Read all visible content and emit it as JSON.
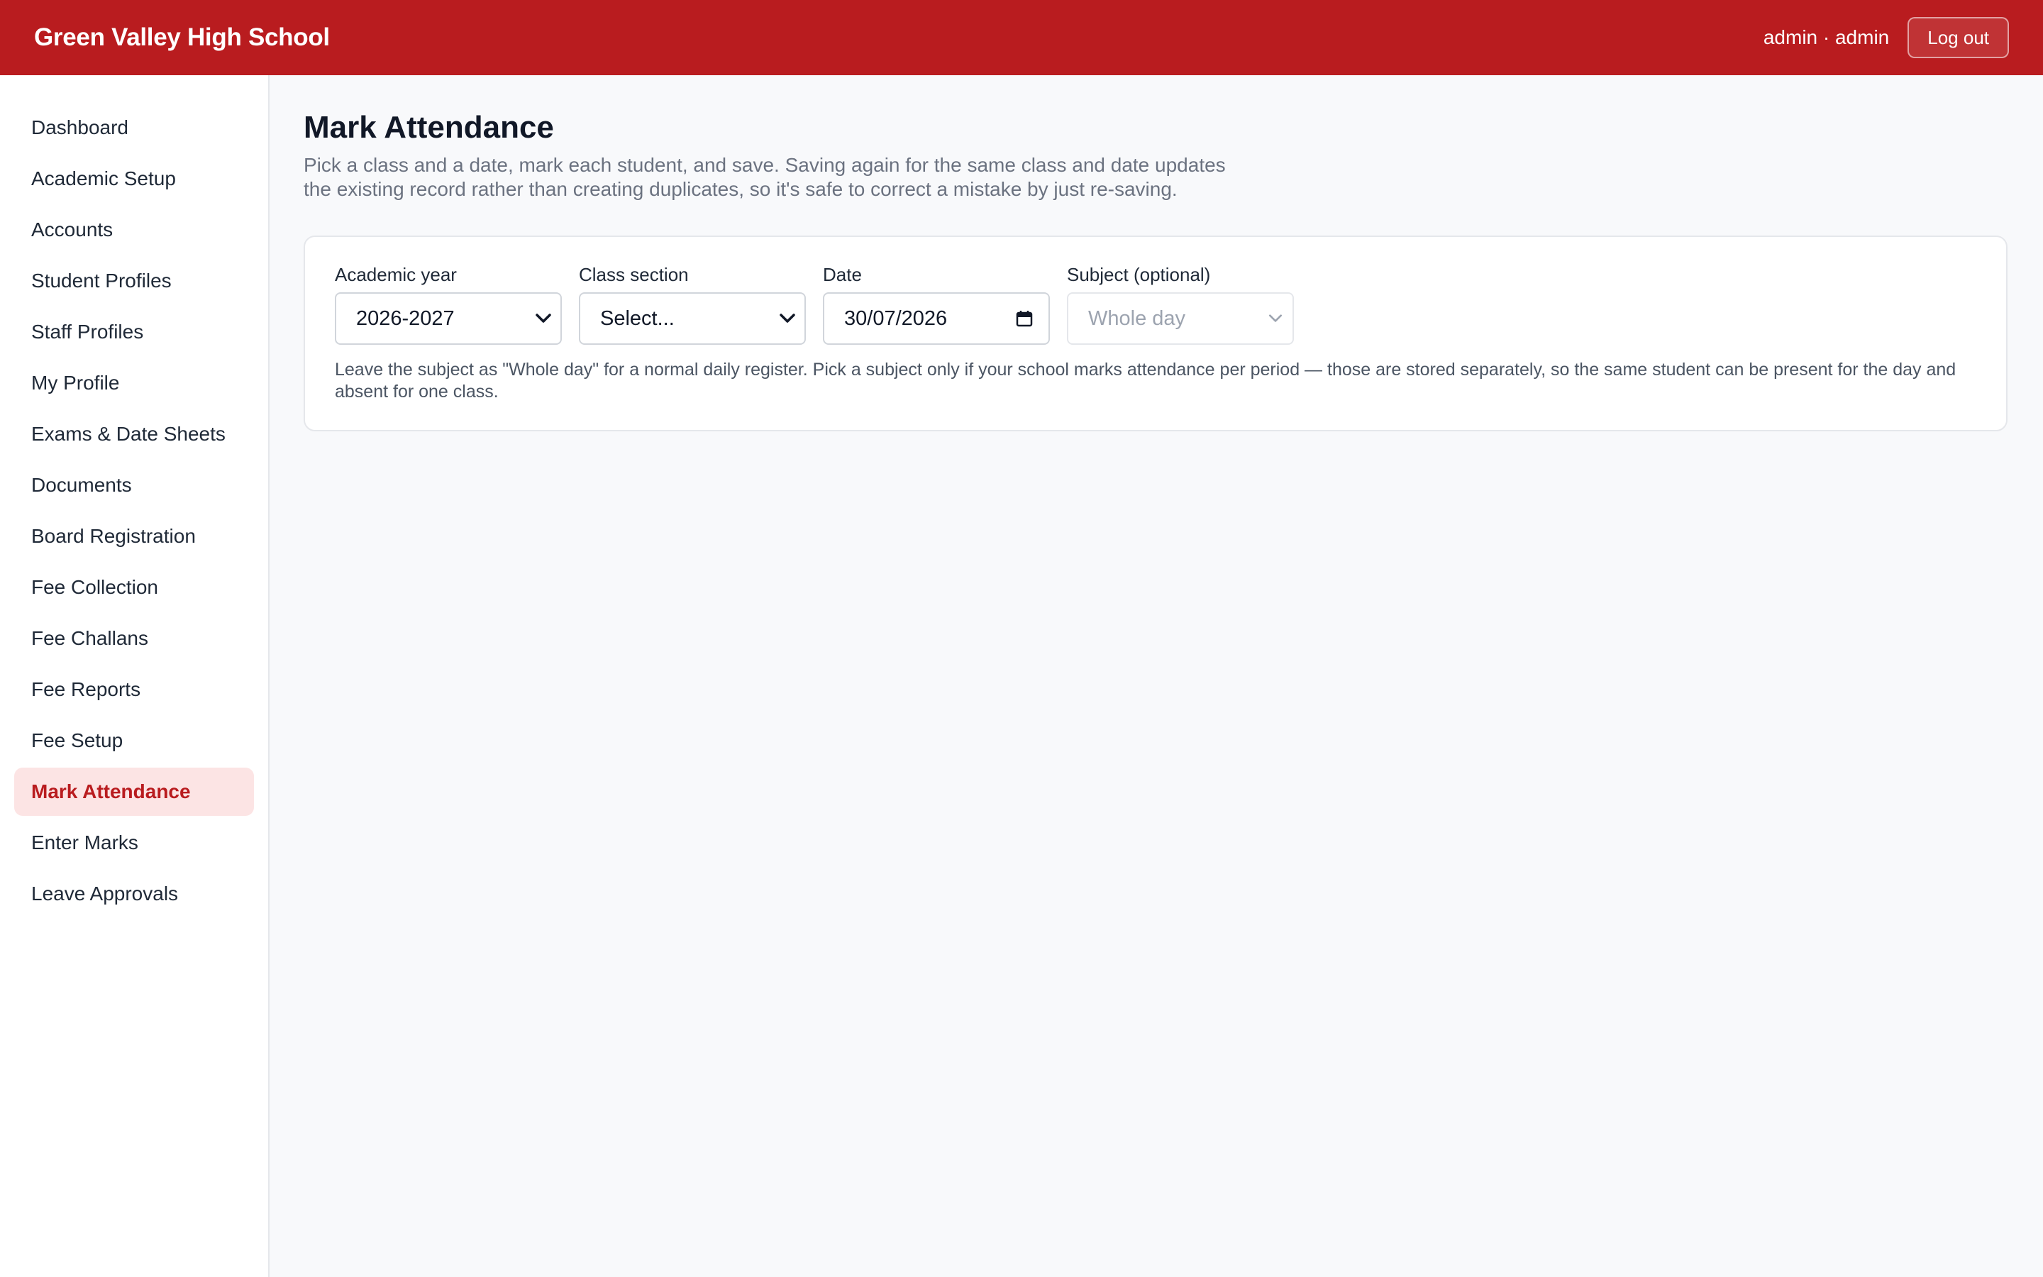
{
  "header": {
    "school_name": "Green Valley High School",
    "user_label": "admin · admin",
    "logout_label": "Log out"
  },
  "sidebar": {
    "items": [
      {
        "label": "Dashboard"
      },
      {
        "label": "Academic Setup"
      },
      {
        "label": "Accounts"
      },
      {
        "label": "Student Profiles"
      },
      {
        "label": "Staff Profiles"
      },
      {
        "label": "My Profile"
      },
      {
        "label": "Exams & Date Sheets"
      },
      {
        "label": "Documents"
      },
      {
        "label": "Board Registration"
      },
      {
        "label": "Fee Collection"
      },
      {
        "label": "Fee Challans"
      },
      {
        "label": "Fee Reports"
      },
      {
        "label": "Fee Setup"
      },
      {
        "label": "Mark Attendance",
        "active": true
      },
      {
        "label": "Enter Marks"
      },
      {
        "label": "Leave Approvals"
      }
    ]
  },
  "page": {
    "title": "Mark Attendance",
    "description": "Pick a class and a date, mark each student, and save. Saving again for the same class and date updates the existing record rather than creating duplicates, so it's safe to correct a mistake by just re-saving."
  },
  "filters": {
    "academic_year": {
      "label": "Academic year",
      "value": "2026-2027"
    },
    "class_section": {
      "label": "Class section",
      "value": "Select..."
    },
    "date": {
      "label": "Date",
      "value": "30/07/2026"
    },
    "subject": {
      "label": "Subject (optional)",
      "value": "Whole day",
      "disabled": true
    },
    "help_text": "Leave the subject as \"Whole day\" for a normal daily register. Pick a subject only if your school marks attendance per period — those are stored separately, so the same student can be present for the day and absent for one class."
  },
  "theme": {
    "brand_color": "#b91c1f",
    "active_nav_bg": "#fce4e4"
  },
  "icons": {
    "select_caret": "chevron-down-icon",
    "date_picker": "calendar-icon"
  }
}
